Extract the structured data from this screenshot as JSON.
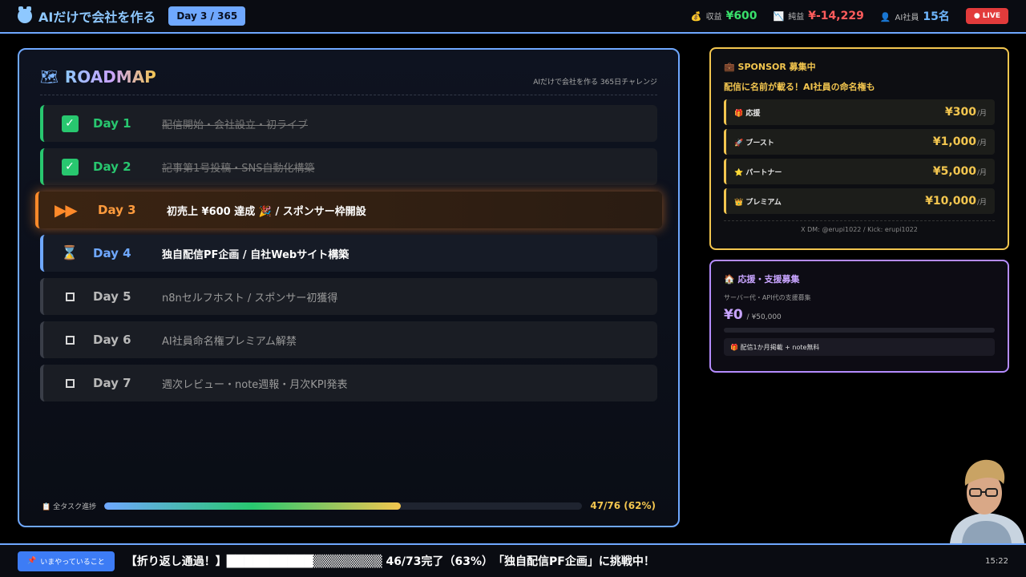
{
  "header": {
    "title": "AIだけで会社を作る",
    "day_badge": "Day 3 / 365",
    "stats": [
      {
        "icon": "money-bag-icon",
        "glyph": "💰",
        "label": "収益",
        "value": "¥600",
        "color": "#39e06b"
      },
      {
        "icon": "chart-down-icon",
        "glyph": "📉",
        "label": "純益",
        "value": "¥-14,229",
        "color": "#ff5c5c"
      },
      {
        "icon": "person-icon",
        "glyph": "👤",
        "label": "AI社員",
        "value": "15名",
        "color": "#6fb7ff"
      }
    ],
    "live": "● LIVE"
  },
  "roadmap": {
    "icon": "🗺",
    "title": "ROADMAP",
    "subtitle": "AIだけで会社を作る 365日チャレンジ",
    "rows": [
      {
        "day": "Day 1",
        "task": "配信開始・会社設立・初ライブ",
        "status": "done"
      },
      {
        "day": "Day 2",
        "task": "記事第1号投稿・SNS自動化構築",
        "status": "done"
      },
      {
        "day": "Day 3",
        "task": "初売上 ¥600 達成 🎉 / スポンサー枠開設",
        "status": "current"
      },
      {
        "day": "Day 4",
        "task": "独自配信PF企画 / 自社Webサイト構築",
        "status": "next"
      },
      {
        "day": "Day 5",
        "task": "n8nセルフホスト / スポンサー初獲得",
        "status": "todo"
      },
      {
        "day": "Day 6",
        "task": "AI社員命名権プレミアム解禁",
        "status": "todo"
      },
      {
        "day": "Day 7",
        "task": "週次レビュー・note週報・月次KPI発表",
        "status": "todo"
      }
    ],
    "progress": {
      "label": "📋 全タスク進捗",
      "value": "47/76 (62%)",
      "fraction": 0.62
    }
  },
  "sponsor": {
    "title": "💼 SPONSOR 募集中",
    "subtitle": "配信に名前が載る！AI社員の命名権も",
    "tiers": [
      {
        "icon": "🎁",
        "name": "応援",
        "price": "¥300",
        "unit": "/月"
      },
      {
        "icon": "🚀",
        "name": "ブースト",
        "price": "¥1,000",
        "unit": "/月"
      },
      {
        "icon": "⭐",
        "name": "パートナー",
        "price": "¥5,000",
        "unit": "/月"
      },
      {
        "icon": "👑",
        "name": "プレミアム",
        "price": "¥10,000",
        "unit": "/月"
      }
    ],
    "footer": "X DM: @erupi1022 / Kick: erupi1022"
  },
  "support": {
    "title": "🏠 応援・支援募集",
    "subtitle": "サーバー代・API代の支援募集",
    "current": "¥0",
    "goal": "/ ¥50,000",
    "fraction": 0,
    "note": "🎁 配信1か月掲載 + note無料"
  },
  "ticker": {
    "button": "いまやっていること",
    "text": "【折り返し通過！】██████████▒▒▒▒▒▒▒▒ 46/73完了（63%）　「独自配信PF企画」に挑戦中！",
    "clock": "15:22"
  }
}
